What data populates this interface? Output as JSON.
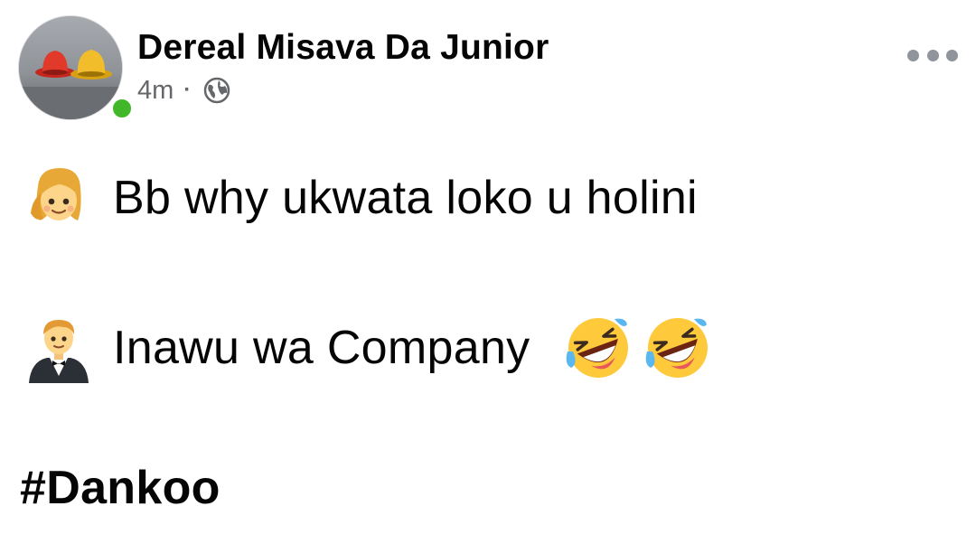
{
  "post": {
    "author": {
      "name": "Dereal Misava Da Junior",
      "online_color": "#42b72a"
    },
    "meta": {
      "time": "4m",
      "separator": "·",
      "audience_icon": "globe-icon"
    },
    "menu_icon": "more-options-icon",
    "content": {
      "line1": {
        "emoji": "woman-emoji",
        "text": "Bb why ukwata loko u holini"
      },
      "line2": {
        "emoji": "man-in-tuxedo-emoji",
        "text": "Inawu wa Company",
        "trailing_emojis": [
          "rolling-on-the-floor-laughing-emoji",
          "rolling-on-the-floor-laughing-emoji"
        ]
      },
      "hashtag": "#Dankoo"
    }
  }
}
